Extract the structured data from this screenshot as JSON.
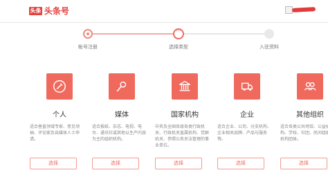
{
  "header": {
    "logo_badge": "头条",
    "logo_text": "头条号"
  },
  "steps": [
    {
      "label": "帐号注册"
    },
    {
      "label": "选择类型"
    },
    {
      "label": "入驻资料"
    }
  ],
  "cards": [
    {
      "title": "个人",
      "desc": "适合垂直领域专家、意见领袖、评论家及自媒体人士申请。",
      "button": "选择",
      "icon": "pencil-icon"
    },
    {
      "title": "媒体",
      "desc": "适合报纸、杂志、电视、电台、通讯社或其他以生产内容为主的组织机构。",
      "button": "选择",
      "icon": "microphone-icon"
    },
    {
      "title": "国家机构",
      "desc": "中央及全国各级各类行政机关、行政机关直属机构、党群机关、参照公务员法管理的事业单位。",
      "button": "选择",
      "icon": "government-building-icon"
    },
    {
      "title": "企业",
      "desc": "适合企业、公司、分支机构、企业相关品牌、产品与服务等。",
      "button": "选择",
      "icon": "delivery-truck-icon"
    },
    {
      "title": "其他组织",
      "desc": "适合各类公共场馆、公益机构、学校、社团、民间组织等机构团体。",
      "button": "选择",
      "icon": "group-users-icon"
    }
  ],
  "colors": {
    "accent": "#ef6a5d",
    "brand_red": "#e5413c"
  }
}
